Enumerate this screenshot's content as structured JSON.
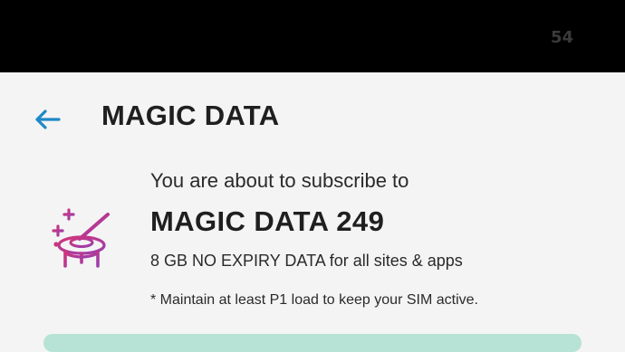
{
  "status_bar": {
    "number": "54"
  },
  "header": {
    "back_icon": "arrow-left-icon",
    "title": "MAGIC DATA"
  },
  "offer": {
    "icon": "magic-wand-hat-icon",
    "subtitle": "You are about to subscribe to",
    "plan_name": "MAGIC DATA 249",
    "description": "8 GB NO EXPIRY DATA for all sites & apps",
    "note": "* Maintain at least P1 load to keep your SIM active."
  },
  "colors": {
    "accent_blue": "#1e88c8",
    "icon_gradient_start": "#d0337a",
    "icon_gradient_end": "#9a3fae",
    "confirm_button": "#b6e3d6",
    "status_bar": "#000000",
    "background": "#f4f4f4"
  }
}
